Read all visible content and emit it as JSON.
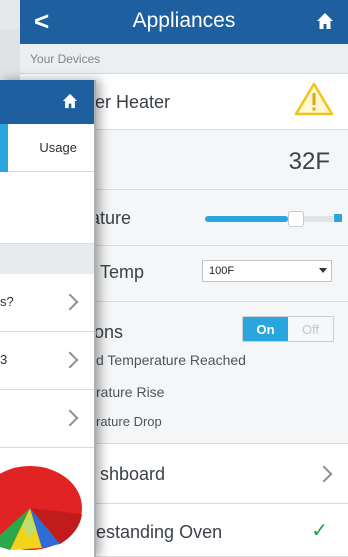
{
  "back_screen": {
    "header": {
      "back_glyph": "<",
      "title": "Appliances",
      "home_icon": "home-icon"
    },
    "section_label": "Your Devices",
    "device_row": {
      "label_partial": "ter Heater",
      "alert_icon": "warning-icon"
    },
    "temperature_row": {
      "value": "32F"
    },
    "slider_row": {
      "label_partial": "ature",
      "level_fraction": 0.63
    },
    "max_temp_row": {
      "label_partial": "Temp",
      "selected": "100F"
    },
    "notifications_row": {
      "label_partial": "ions",
      "toggle_on": "On",
      "toggle_off": "Off",
      "items": [
        "d Temperature Reached",
        "rature Rise",
        "rature Drop"
      ]
    },
    "dashboard_row": {
      "label_partial": "shboard"
    },
    "oven_row": {
      "label_partial": "estanding Oven",
      "status_icon": "checkmark-icon"
    }
  },
  "front_screen": {
    "header": {
      "home_icon": "home-icon"
    },
    "tab_usage": "Usage",
    "rows": [
      {
        "text": "s?"
      },
      {
        "text": "3"
      },
      {
        "text": ""
      }
    ],
    "pie_colors": {
      "red": "#e02424",
      "green": "#2aa84a",
      "yellow": "#f2d21a",
      "blue": "#2b6fd6"
    }
  },
  "colors": {
    "header": "#1e5fa0",
    "accent": "#2aa6df"
  }
}
